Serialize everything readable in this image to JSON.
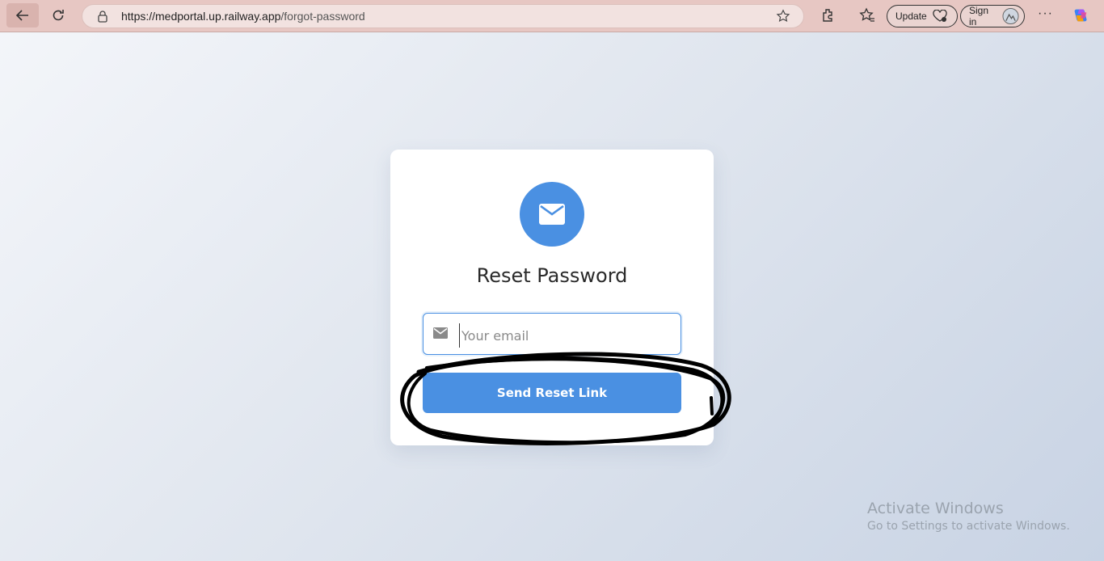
{
  "browser": {
    "url_host": "https://medportal.up.railway.app",
    "url_path": "/forgot-password",
    "update_label": "Update",
    "signin_label": "Sign in",
    "more_label": "···",
    "icons": [
      "back-icon",
      "reload-icon",
      "lock-icon",
      "star-icon",
      "extensions-icon",
      "favorites-icon",
      "update-icon",
      "profile-icon",
      "copilot-icon"
    ]
  },
  "card": {
    "title": "Reset Password",
    "email_placeholder": "Your email",
    "email_value": "",
    "submit_label": "Send Reset Link",
    "accent": "#4a90e2",
    "icon": "envelope-icon"
  },
  "watermark": {
    "title": "Activate Windows",
    "subtitle": "Go to Settings to activate Windows."
  }
}
